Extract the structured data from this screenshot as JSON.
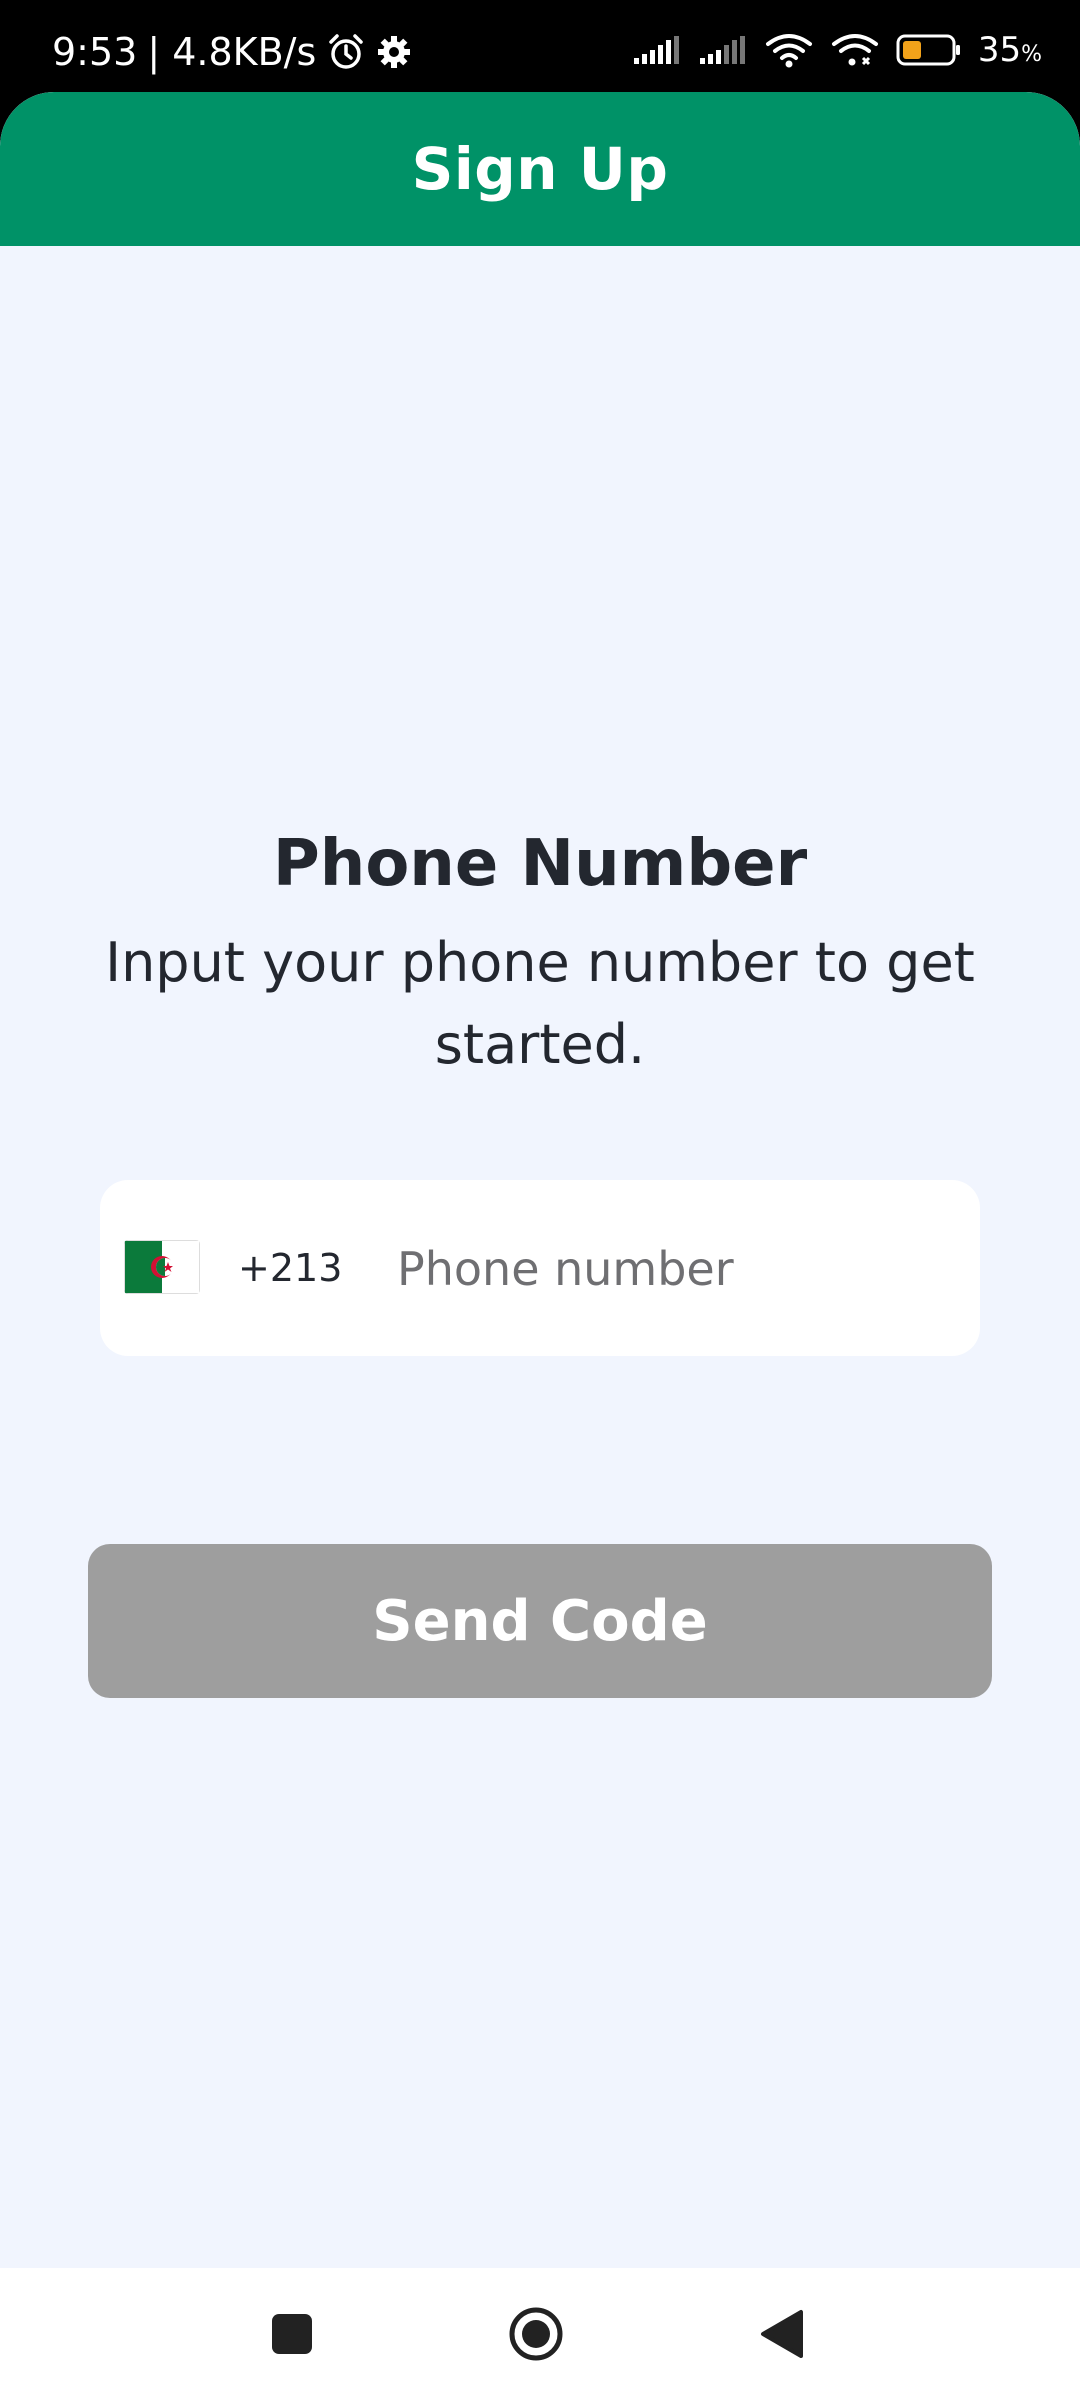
{
  "status_bar": {
    "time": "9:53",
    "network_speed": "| 4.8KB/s",
    "battery_percent": "35",
    "battery_unit": "%",
    "icons": [
      "alarm-icon",
      "gear-icon",
      "signal-icon",
      "signal-icon",
      "wifi-icon",
      "hotspot-icon",
      "battery-icon"
    ]
  },
  "header": {
    "title": "Sign Up"
  },
  "content": {
    "title": "Phone Number",
    "subtitle": "Input your phone number to get started."
  },
  "phone_field": {
    "country_flag": "algeria-flag-icon",
    "dial_code": "+213",
    "placeholder": "Phone number",
    "value": ""
  },
  "actions": {
    "send_code_label": "Send Code"
  },
  "nav_bar": {
    "icons": [
      "recent-apps-icon",
      "home-icon",
      "back-icon"
    ]
  },
  "colors": {
    "brand": "#009267",
    "background": "#f1f5fe",
    "button_disabled": "#9e9e9e",
    "text": "#23272f"
  }
}
